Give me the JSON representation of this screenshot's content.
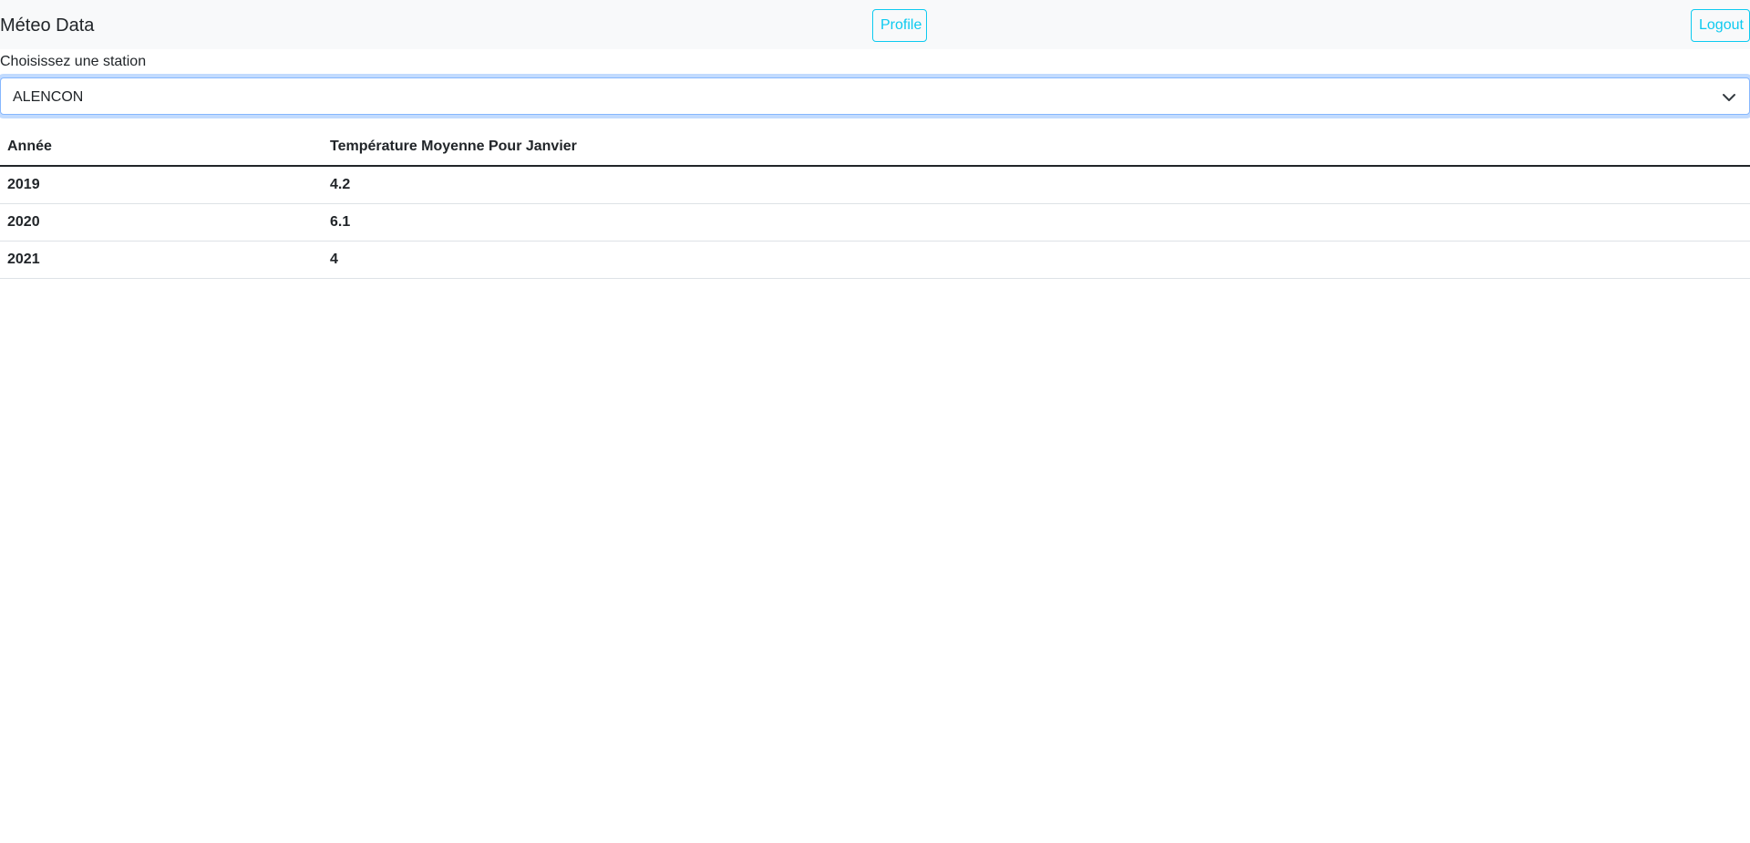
{
  "navbar": {
    "brand": "Méteo Data",
    "profile_label": "Profile",
    "logout_label": "Logout"
  },
  "station": {
    "label": "Choisissez une station",
    "selected": "ALENCON"
  },
  "table": {
    "headers": [
      "Année",
      "Température Moyenne Pour Janvier"
    ],
    "rows": [
      [
        "2019",
        "4.2"
      ],
      [
        "2020",
        "6.1"
      ],
      [
        "2021",
        "4"
      ]
    ]
  },
  "colors": {
    "accent": "#0dcaf0",
    "focus_border": "#86b7fe",
    "navbar_bg": "#f8f9fa"
  }
}
